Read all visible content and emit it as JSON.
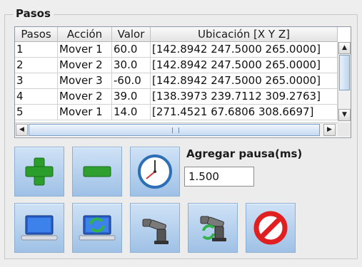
{
  "panel": {
    "title": "Pasos"
  },
  "table": {
    "headers": [
      "Pasos",
      "Acción",
      "Valor",
      "Ubicación [X Y Z]"
    ],
    "rows": [
      [
        "1",
        "Mover 1",
        "60.0",
        "[142.8942 247.5000 265.0000]"
      ],
      [
        "2",
        "Mover 2",
        "30.0",
        "[142.8942 247.5000 265.0000]"
      ],
      [
        "3",
        "Mover 3",
        "-60.0",
        "[142.8942 247.5000 265.0000]"
      ],
      [
        "4",
        "Mover 2",
        "39.0",
        "[138.3973 239.7112 309.2763]"
      ],
      [
        "5",
        "Mover 1",
        "14.0",
        "[271.4521 67.6806 308.6697]"
      ]
    ]
  },
  "scroll": {
    "up": "▲",
    "down": "▼",
    "left": "◀",
    "right": "▶"
  },
  "pause": {
    "label": "Agregar pausa(ms)",
    "value": "1.500"
  },
  "toolbar": {
    "row1": [
      "plus-icon",
      "minus-icon",
      "clock-icon"
    ],
    "row2": [
      "laptop-icon",
      "laptop-sync-icon",
      "robot-arm-icon",
      "robot-sync-icon",
      "stop-icon"
    ]
  },
  "colors": {
    "button_bg": "#b7d2ef",
    "plus": "#2a9d2a",
    "minus": "#2f9f2f",
    "stop": "#e02020"
  }
}
